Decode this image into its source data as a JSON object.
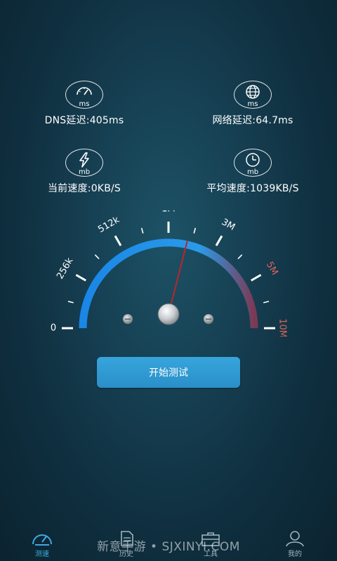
{
  "stats": {
    "dns": {
      "unit": "ms",
      "label": "DNS延迟:405ms",
      "icon": "speedometer-icon"
    },
    "network": {
      "unit": "ms",
      "label": "网络延迟:64.7ms",
      "icon": "globe-icon"
    },
    "current": {
      "unit": "mb",
      "label": "当前速度:0KB/S",
      "icon": "lightning-icon"
    },
    "average": {
      "unit": "mb",
      "label": "平均速度:1039KB/S",
      "icon": "clock-icon"
    }
  },
  "gauge": {
    "labels": [
      "0",
      "256k",
      "512k",
      "1M",
      "3M",
      "5M",
      "10M"
    ],
    "needle_value": 0.58,
    "colors": {
      "arc_start": "#1a86e6",
      "arc_end": "#7a3a55",
      "needle": "#b8262c",
      "danger_label": "#e0655e"
    }
  },
  "start_button": {
    "label": "开始测试"
  },
  "tabs": [
    {
      "label": "测速",
      "icon": "speed-gauge-icon",
      "active": true
    },
    {
      "label": "历史",
      "icon": "document-icon",
      "active": false
    },
    {
      "label": "工具",
      "icon": "toolbox-icon",
      "active": false
    },
    {
      "label": "我的",
      "icon": "user-icon",
      "active": false
    }
  ],
  "watermark": "新意手游 • SJXINYI.COM"
}
